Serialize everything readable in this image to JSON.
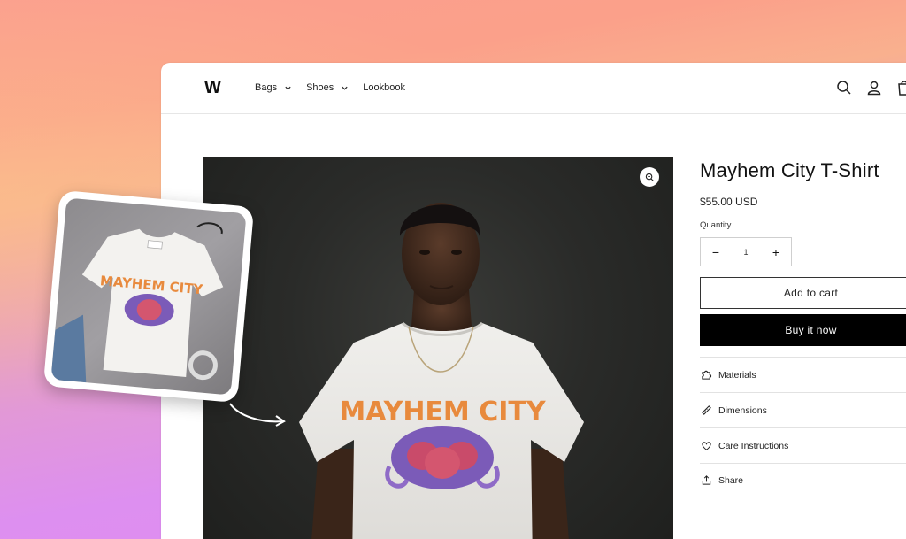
{
  "header": {
    "logo": "W",
    "nav": [
      {
        "label": "Bags",
        "has_dropdown": true
      },
      {
        "label": "Shoes",
        "has_dropdown": true
      },
      {
        "label": "Lookbook",
        "has_dropdown": false
      }
    ],
    "icons": [
      "search-icon",
      "account-icon",
      "cart-icon"
    ]
  },
  "product": {
    "title": "Mayhem City T-Shirt",
    "price": "$55.00 USD",
    "quantity_label": "Quantity",
    "quantity": "1",
    "decrement": "−",
    "increment": "+",
    "add_to_cart": "Add to cart",
    "buy_now": "Buy it now",
    "shirt_print": "MAYHEM CITY"
  },
  "accordion": [
    {
      "label": "Materials",
      "icon": "puzzle-icon"
    },
    {
      "label": "Dimensions",
      "icon": "ruler-icon"
    },
    {
      "label": "Care Instructions",
      "icon": "heart-icon"
    }
  ],
  "share_label": "Share",
  "colors": {
    "accent": "#000000",
    "background_top": "#fb9e8e",
    "background_bottom": "#e28cf2"
  }
}
